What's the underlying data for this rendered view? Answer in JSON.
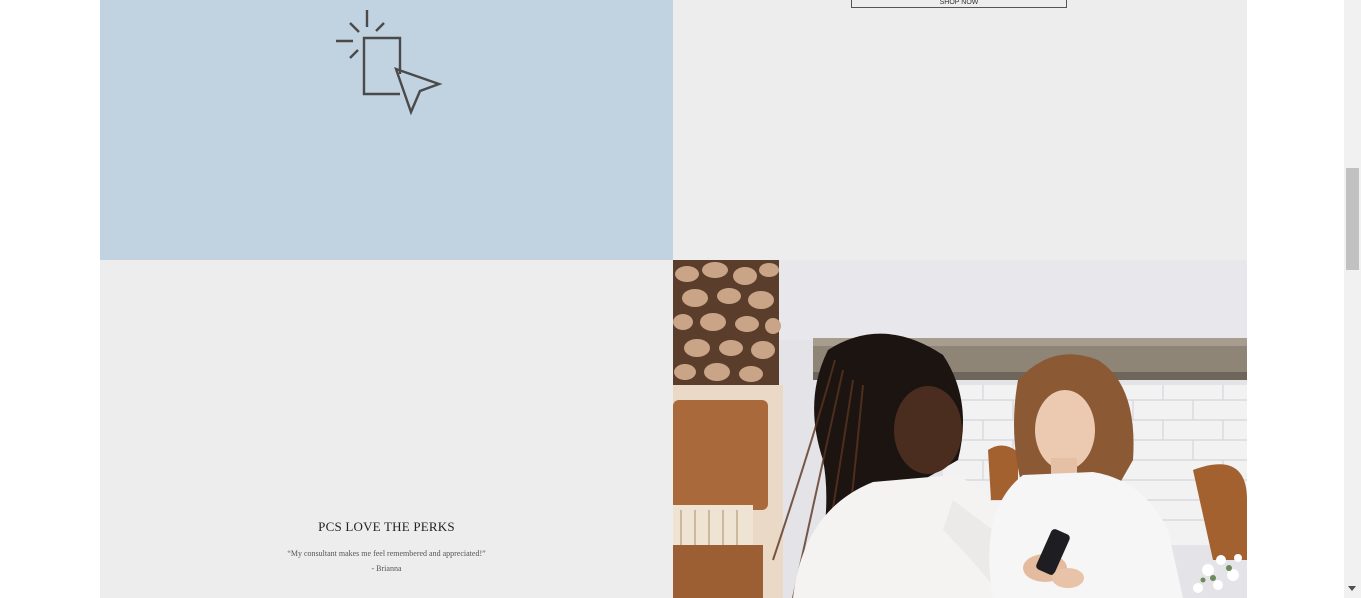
{
  "shop_tile": {
    "button_label": "SHOP NOW"
  },
  "click_tile": {
    "icon": "cursor-click-icon",
    "background": "#c1d2e0"
  },
  "perks_tile": {
    "title": "PCS LOVE THE PERKS",
    "quote": "“My consultant makes me feel remembered and appreciated!”",
    "author": "- Brianna"
  },
  "photo_tile": {
    "image": "two-women-looking-at-phone-photo"
  },
  "colors": {
    "tile_gray": "#ededed",
    "tile_blue": "#c1d2e0",
    "text_dark": "#222222"
  }
}
